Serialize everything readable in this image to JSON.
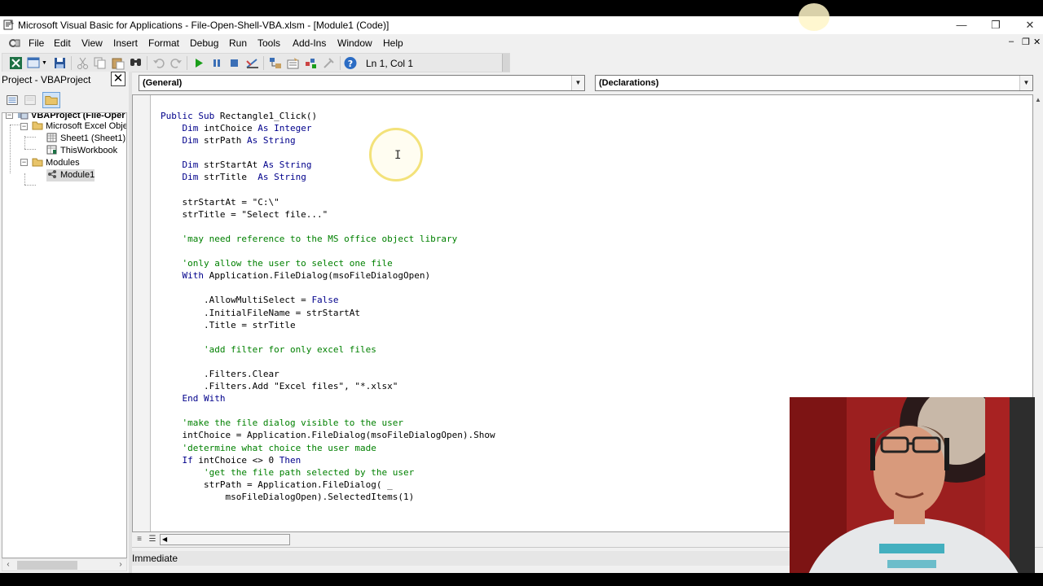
{
  "window": {
    "title": "Microsoft Visual Basic for Applications - File-Open-Shell-VBA.xlsm - [Module1 (Code)]",
    "controls": {
      "minimize": "—",
      "restore": "❐",
      "close": "✕"
    }
  },
  "menubar": {
    "items": [
      "File",
      "Edit",
      "View",
      "Insert",
      "Format",
      "Debug",
      "Run",
      "Tools",
      "Add-Ins",
      "Window",
      "Help"
    ],
    "mdi_controls": {
      "minimize": "–",
      "restore": "❐",
      "close": "✕"
    }
  },
  "toolbar": {
    "position": "Ln 1, Col 1",
    "buttons": [
      "view-excel-icon",
      "insert-module-icon",
      "save-icon",
      "cut-icon",
      "copy-icon",
      "paste-icon",
      "find-icon",
      "undo-icon",
      "redo-icon",
      "run-icon",
      "break-icon",
      "reset-icon",
      "design-mode-icon",
      "project-explorer-icon",
      "properties-icon",
      "object-browser-icon",
      "toolbox-icon",
      "help-icon"
    ]
  },
  "project": {
    "title": "Project - VBAProject",
    "close": "✕",
    "tree": {
      "root": "VBAProject (File-Oper",
      "excel_objects": "Microsoft Excel Objec",
      "sheet1": "Sheet1 (Sheet1)",
      "thisworkbook": "ThisWorkbook",
      "modules": "Modules",
      "module1": "Module1"
    }
  },
  "code": {
    "object_combo": "(General)",
    "procedure_combo": "(Declarations)",
    "lines": [
      [
        {
          "t": "Public Sub ",
          "k": "kw"
        },
        {
          "t": "Rectangle1_Click()",
          "k": ""
        }
      ],
      [
        {
          "t": "    Dim ",
          "k": "kw"
        },
        {
          "t": "intChoice ",
          "k": ""
        },
        {
          "t": "As Integer",
          "k": "kw"
        }
      ],
      [
        {
          "t": "    Dim ",
          "k": "kw"
        },
        {
          "t": "strPath ",
          "k": ""
        },
        {
          "t": "As String",
          "k": "kw"
        }
      ],
      [],
      [
        {
          "t": "    Dim ",
          "k": "kw"
        },
        {
          "t": "strStartAt ",
          "k": ""
        },
        {
          "t": "As String",
          "k": "kw"
        }
      ],
      [
        {
          "t": "    Dim ",
          "k": "kw"
        },
        {
          "t": "strTitle  ",
          "k": ""
        },
        {
          "t": "As String",
          "k": "kw"
        }
      ],
      [],
      [
        {
          "t": "    strStartAt = \"C:\\\"",
          "k": ""
        }
      ],
      [
        {
          "t": "    strTitle = \"Select file...\"",
          "k": ""
        }
      ],
      [],
      [
        {
          "t": "    'may need reference to the MS office object library",
          "k": "cm"
        }
      ],
      [],
      [
        {
          "t": "    'only allow the user to select one file",
          "k": "cm"
        }
      ],
      [
        {
          "t": "    With ",
          "k": "kw"
        },
        {
          "t": "Application.FileDialog(msoFileDialogOpen)",
          "k": ""
        }
      ],
      [],
      [
        {
          "t": "        .AllowMultiSelect = ",
          "k": ""
        },
        {
          "t": "False",
          "k": "kw"
        }
      ],
      [
        {
          "t": "        .InitialFileName = strStartAt",
          "k": ""
        }
      ],
      [
        {
          "t": "        .Title = strTitle",
          "k": ""
        }
      ],
      [],
      [
        {
          "t": "        'add filter for only excel files",
          "k": "cm"
        }
      ],
      [],
      [
        {
          "t": "        .Filters.Clear",
          "k": ""
        }
      ],
      [
        {
          "t": "        .Filters.Add \"Excel files\", \"*.xlsx\"",
          "k": ""
        }
      ],
      [
        {
          "t": "    End With",
          "k": "kw"
        }
      ],
      [],
      [
        {
          "t": "    'make the file dialog visible to the user",
          "k": "cm"
        }
      ],
      [
        {
          "t": "    intChoice = Application.FileDialog(msoFileDialogOpen).Show",
          "k": ""
        }
      ],
      [
        {
          "t": "    'determine what choice the user made",
          "k": "cm"
        }
      ],
      [
        {
          "t": "    If ",
          "k": "kw"
        },
        {
          "t": "intChoice <> 0 ",
          "k": ""
        },
        {
          "t": "Then",
          "k": "kw"
        }
      ],
      [
        {
          "t": "        'get the file path selected by the user",
          "k": "cm"
        }
      ],
      [
        {
          "t": "        strPath = Application.FileDialog( _",
          "k": ""
        }
      ],
      [
        {
          "t": "            msoFileDialogOpen).SelectedItems(1)",
          "k": ""
        }
      ]
    ]
  },
  "immediate": {
    "title": "Immediate"
  },
  "colors": {
    "keyword": "#00008b",
    "comment": "#008000",
    "cursor_highlight": "#f3e27a"
  }
}
